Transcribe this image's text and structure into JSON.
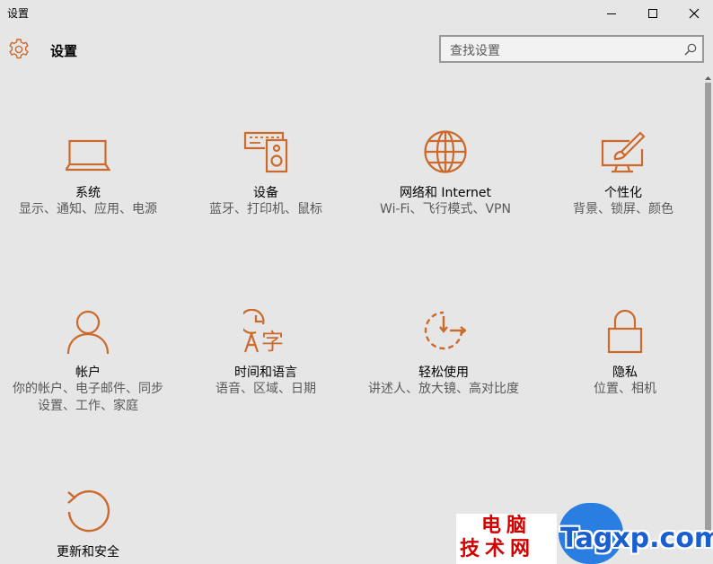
{
  "window": {
    "title": "设置",
    "controls": [
      "minimize",
      "maximize",
      "close"
    ]
  },
  "header": {
    "title": "设置",
    "search_placeholder": "查找设置"
  },
  "colors": {
    "accent": "#cc6a2c",
    "background": "#e6e6e6",
    "description": "#595959"
  },
  "tiles": [
    {
      "title": "系统",
      "desc": "显示、通知、应用、电源",
      "icon": "laptop-icon"
    },
    {
      "title": "设备",
      "desc": "蓝牙、打印机、鼠标",
      "icon": "devices-icon"
    },
    {
      "title": "网络和 Internet",
      "desc": "Wi-Fi、飞行模式、VPN",
      "icon": "globe-icon"
    },
    {
      "title": "个性化",
      "desc": "背景、锁屏、颜色",
      "icon": "personalization-icon"
    },
    {
      "title": "帐户",
      "desc": "你的帐户、电子邮件、同步设置、工作、家庭",
      "icon": "person-icon"
    },
    {
      "title": "时间和语言",
      "desc": "语音、区域、日期",
      "icon": "time-language-icon"
    },
    {
      "title": "轻松使用",
      "desc": "讲述人、放大镜、高对比度",
      "icon": "ease-of-access-icon"
    },
    {
      "title": "隐私",
      "desc": "位置、相机",
      "icon": "lock-icon"
    },
    {
      "title": "更新和安全",
      "desc": "",
      "icon": "refresh-icon"
    }
  ],
  "watermark": {
    "cn_line1": "电脑",
    "cn_line2": "技术网",
    "en": "Tagxp.com"
  }
}
